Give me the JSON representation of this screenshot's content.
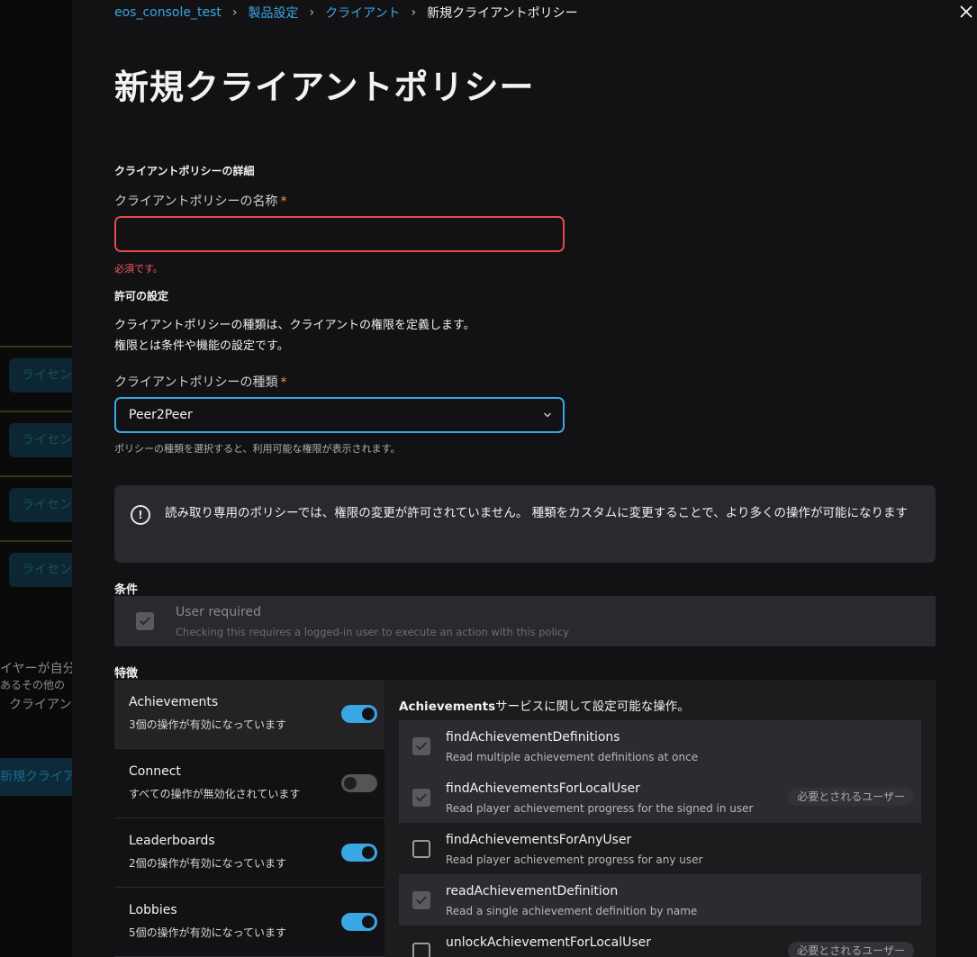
{
  "background": {
    "pill_label": "ライセン",
    "text_lines": [
      "イヤーが自分",
      "あるその他の",
      "クライアン"
    ],
    "button_label": "新規クライア"
  },
  "breadcrumb": {
    "items": [
      "eos_console_test",
      "製品設定",
      "クライアント"
    ],
    "current": "新規クライアントポリシー"
  },
  "page_title": "新規クライアントポリシー",
  "details": {
    "section_title": "クライアントポリシーの詳細",
    "name_label": "クライアントポリシーの名称",
    "name_required_mark": "*",
    "name_value": "",
    "name_error": "必須です。"
  },
  "permissions": {
    "section_title": "許可の設定",
    "description_line1": "クライアントポリシーの種類は、クライアントの権限を定義します。",
    "description_line2": "権限とは条件や機能の設定です。",
    "type_label": "クライアントポリシーの種類",
    "type_required_mark": "*",
    "type_value": "Peer2Peer",
    "type_hint": "ポリシーの種類を選択すると、利用可能な権限が表示されます。"
  },
  "banner": {
    "text": "読み取り専用のポリシーでは、権限の変更が許可されていません。 種類をカスタムに変更することで、より多くの操作が可能になります"
  },
  "conditions": {
    "heading": "条件",
    "items": [
      {
        "title": "User required",
        "description": "Checking this requires a logged-in user to execute an action with this policy",
        "checked": true
      }
    ]
  },
  "features": {
    "heading": "特徴",
    "items": [
      {
        "name": "Achievements",
        "status": "3個の操作が有効になっています",
        "enabled": true
      },
      {
        "name": "Connect",
        "status": "すべての操作が無効化されています",
        "enabled": false
      },
      {
        "name": "Leaderboards",
        "status": "2個の操作が有効になっています",
        "enabled": true
      },
      {
        "name": "Lobbies",
        "status": "5個の操作が有効になっています",
        "enabled": true
      }
    ]
  },
  "operations": {
    "heading_service": "Achievements",
    "heading_suffix": "サービスに関して設定可能な操作。",
    "badge_label": "必要とされるユーザー",
    "items": [
      {
        "name": "findAchievementDefinitions",
        "description": "Read multiple achievement definitions at once",
        "checked": true
      },
      {
        "name": "findAchievementsForLocalUser",
        "description": "Read player achievement progress for the signed in user",
        "checked": true
      },
      {
        "name": "findAchievementsForAnyUser",
        "description": "Read player achievement progress for any user",
        "checked": false
      },
      {
        "name": "readAchievementDefinition",
        "description": "Read a single achievement definition by name",
        "checked": true
      },
      {
        "name": "unlockAchievementForLocalUser",
        "description": "",
        "checked": false
      }
    ]
  },
  "colors": {
    "accent": "#3aa6e3",
    "error": "#e5484d",
    "required": "#f0a020"
  }
}
